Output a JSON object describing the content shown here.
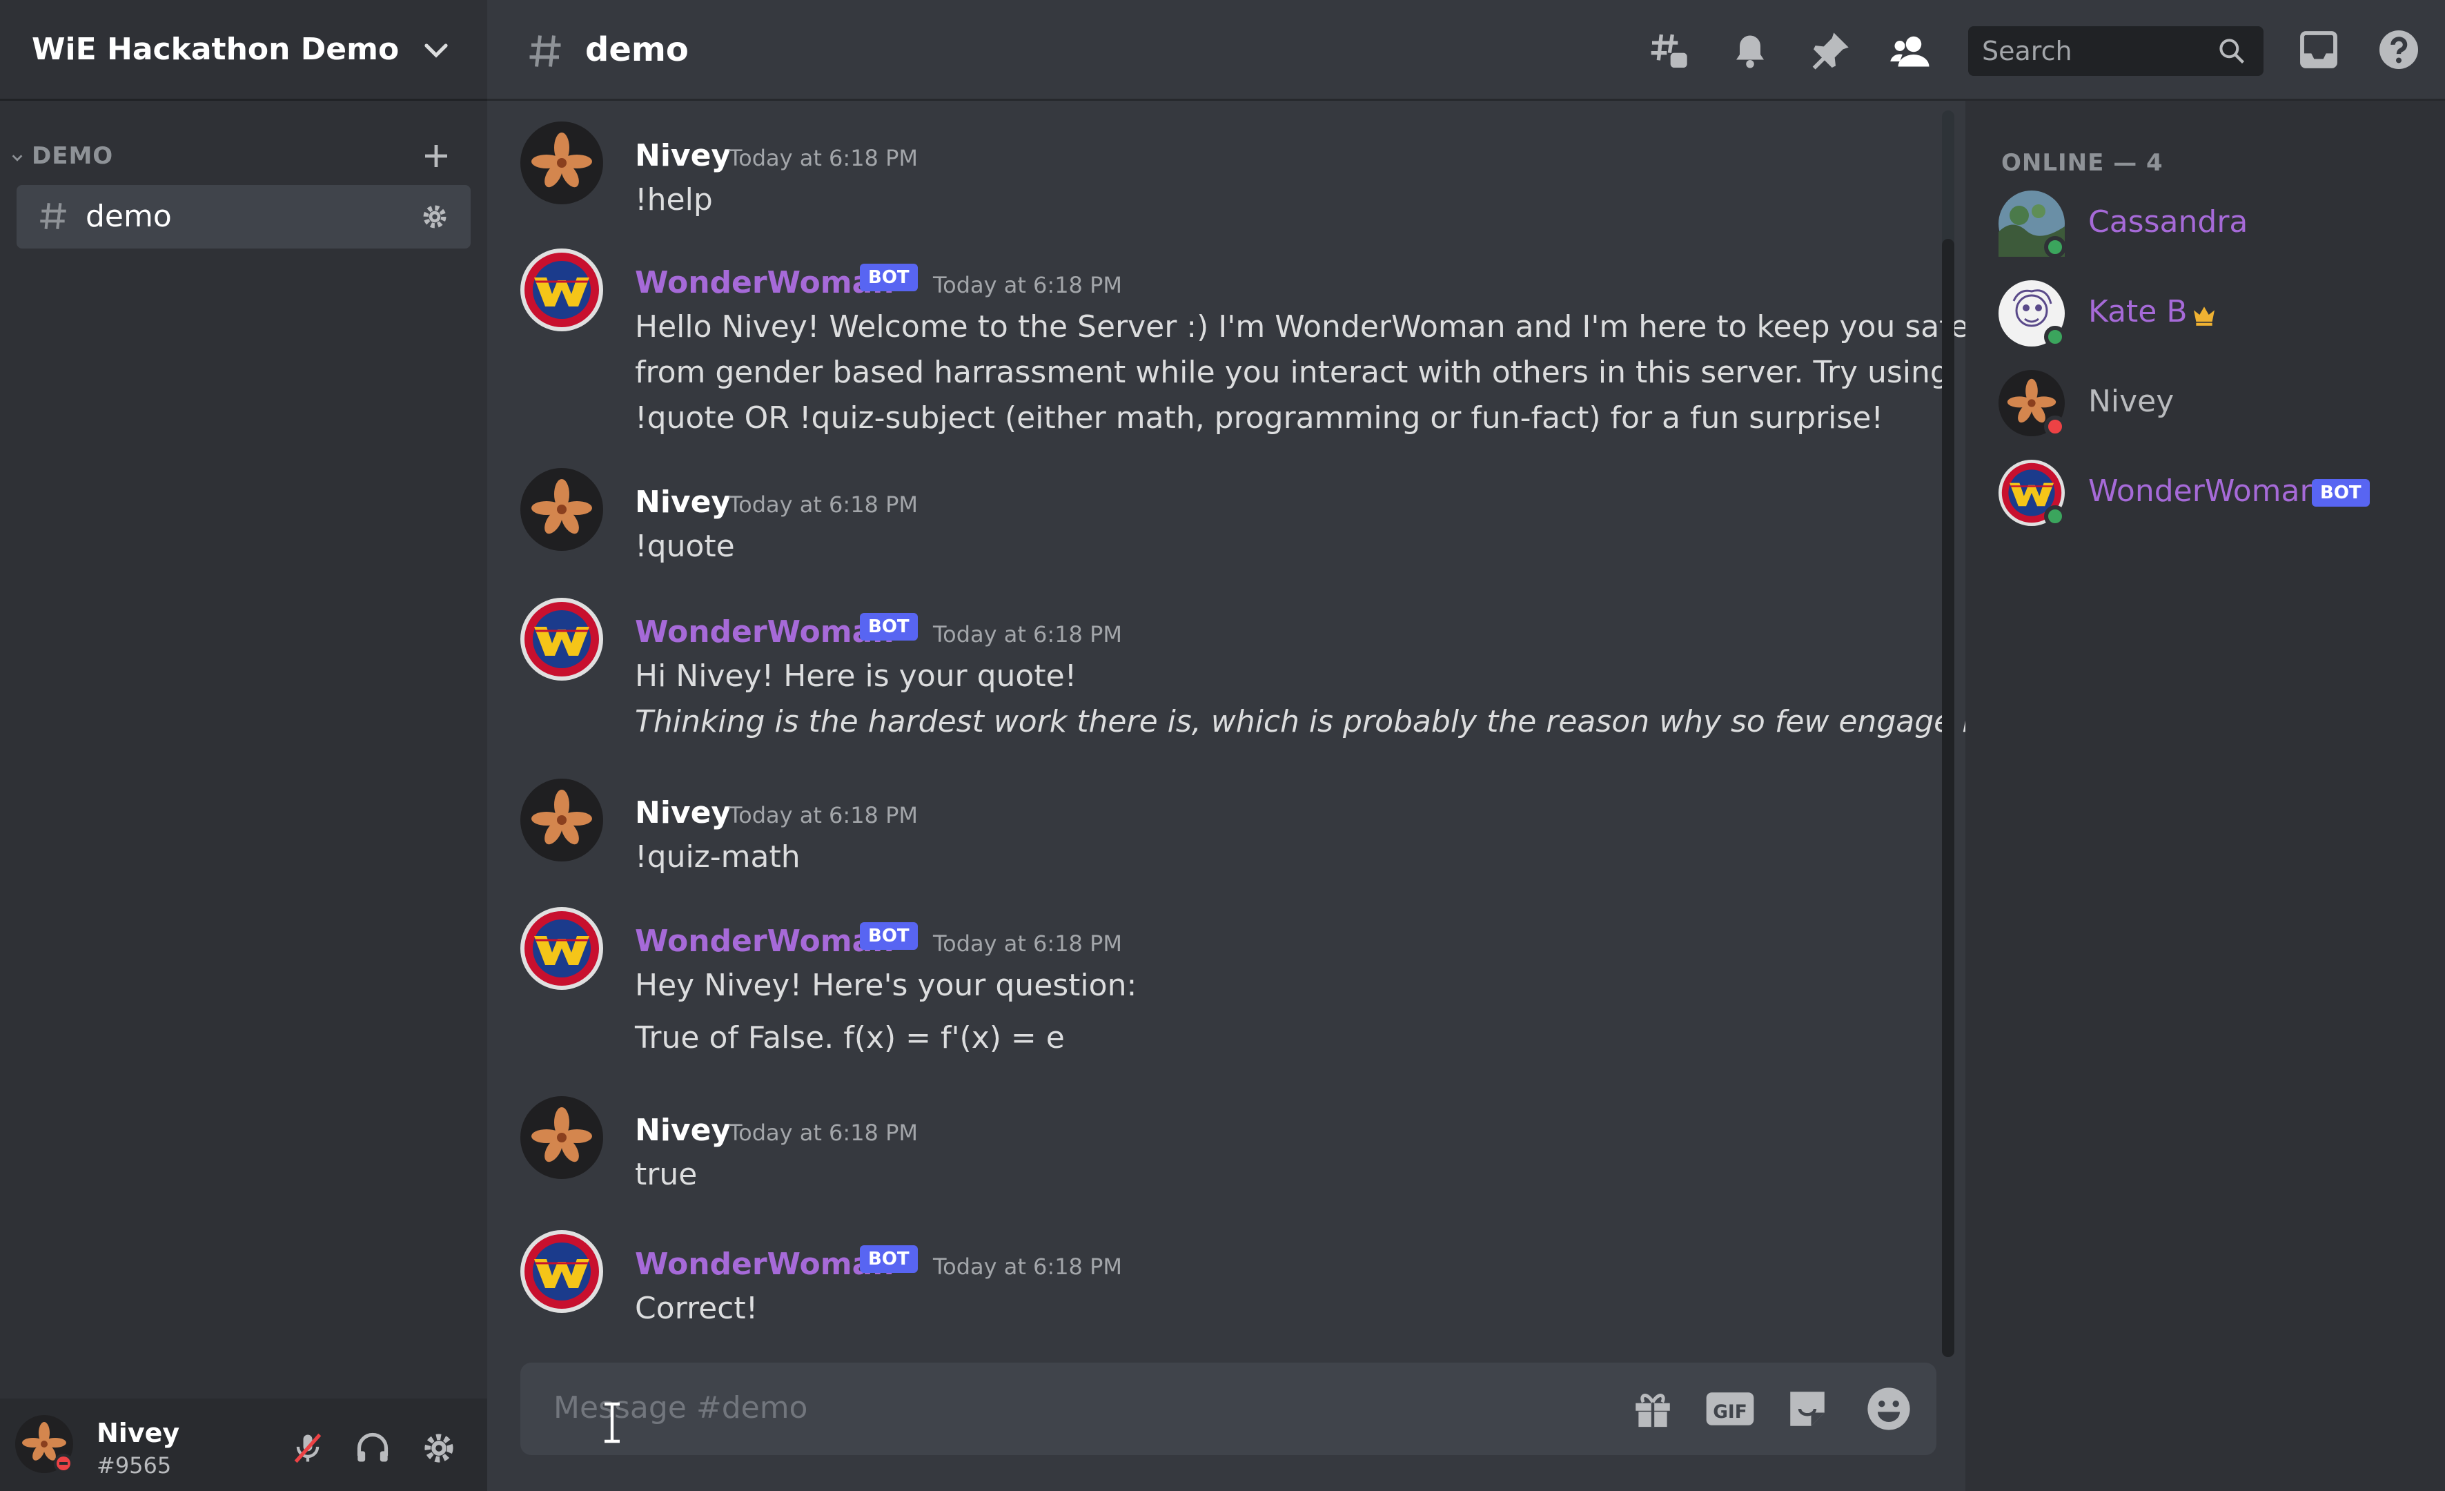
{
  "server": {
    "name": "WiE Hackathon Demo"
  },
  "category": {
    "label": "DEMO"
  },
  "channel": {
    "label": "demo"
  },
  "topbar": {
    "channel_title": "demo",
    "search_placeholder": "Search"
  },
  "user_panel": {
    "name": "Nivey",
    "tag": "#9565"
  },
  "messages": [
    {
      "author": "Nivey",
      "bot": false,
      "time": "Today at 6:18 PM",
      "lines": [
        "!help"
      ]
    },
    {
      "author": "WonderWoman",
      "bot": true,
      "badge": "BOT",
      "time": "Today at 6:18 PM",
      "lines": [
        "Hello Nivey! Welcome to the Server :) I'm WonderWoman and I'm here to keep you safe",
        "from gender based harrassment while you interact with others in this server. Try using",
        "!quote OR !quiz-subject (either math, programming or fun-fact) for a fun surprise!"
      ]
    },
    {
      "author": "Nivey",
      "bot": false,
      "time": "Today at 6:18 PM",
      "lines": [
        "!quote"
      ]
    },
    {
      "author": "WonderWoman",
      "bot": true,
      "badge": "BOT",
      "time": "Today at 6:18 PM",
      "lines": [
        "Hi Nivey! Here is your quote!",
        "Thinking is the hardest work there is, which is probably the reason why so few engage in it."
      ]
    },
    {
      "author": "Nivey",
      "bot": false,
      "time": "Today at 6:18 PM",
      "lines": [
        "!quiz-math"
      ]
    },
    {
      "author": "WonderWoman",
      "bot": true,
      "badge": "BOT",
      "time": "Today at 6:18 PM",
      "lines": [
        "Hey Nivey! Here's your question:",
        "True of False. f(x) = f'(x) = e"
      ]
    },
    {
      "author": "Nivey",
      "bot": false,
      "time": "Today at 6:18 PM",
      "lines": [
        "true"
      ]
    },
    {
      "author": "WonderWoman",
      "bot": true,
      "badge": "BOT",
      "time": "Today at 6:18 PM",
      "lines": [
        "Correct!"
      ]
    }
  ],
  "composer": {
    "placeholder": "Message #demo"
  },
  "members": {
    "header": "ONLINE — 4",
    "list": [
      {
        "name": "Cassandra",
        "status": "online",
        "color": "#a66ad8"
      },
      {
        "name": "Kate B",
        "status": "online",
        "color": "#a66ad8",
        "crown": true
      },
      {
        "name": "Nivey",
        "status": "dnd",
        "color": "#b9bbbe"
      },
      {
        "name": "WonderWoman",
        "status": "online",
        "color": "#a66ad8",
        "badge": "BOT"
      }
    ]
  },
  "colors": {
    "bg": "#36393f",
    "sidebar": "#2f3136",
    "bot_purple": "#a66ad8",
    "blurple": "#5865f2",
    "online": "#3ba55d",
    "dnd": "#ed4245"
  }
}
